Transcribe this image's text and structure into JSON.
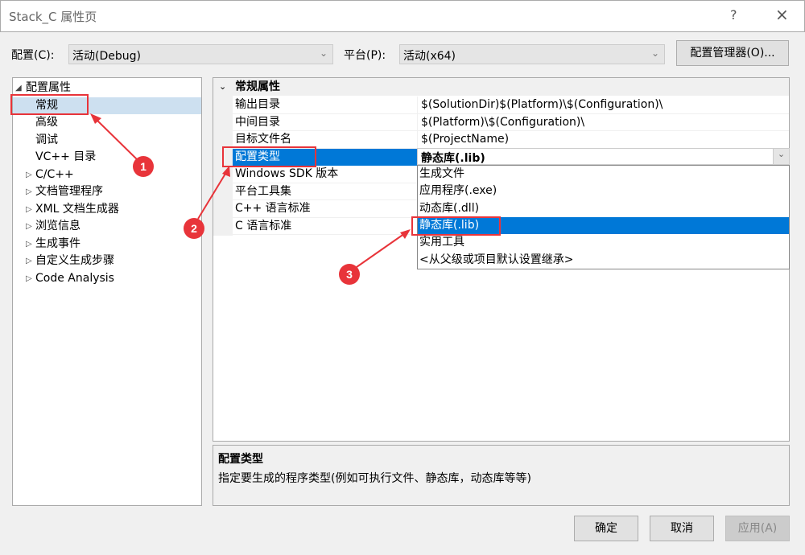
{
  "window": {
    "title": "Stack_C 属性页",
    "help": "?",
    "close": "×"
  },
  "toolbar": {
    "config_label": "配置(C):",
    "config_value": "活动(Debug)",
    "platform_label": "平台(P):",
    "platform_value": "活动(x64)",
    "config_manager": "配置管理器(O)..."
  },
  "tree": {
    "items": [
      {
        "label": "配置属性",
        "expander": "◢"
      },
      {
        "label": "常规"
      },
      {
        "label": "高级"
      },
      {
        "label": "调试"
      },
      {
        "label": "VC++ 目录"
      },
      {
        "label": "C/C++",
        "expander": "▷"
      },
      {
        "label": "文档管理程序",
        "expander": "▷"
      },
      {
        "label": "XML 文档生成器",
        "expander": "▷"
      },
      {
        "label": "浏览信息",
        "expander": "▷"
      },
      {
        "label": "生成事件",
        "expander": "▷"
      },
      {
        "label": "自定义生成步骤",
        "expander": "▷"
      },
      {
        "label": "Code Analysis",
        "expander": "▷"
      }
    ],
    "selected": "常规"
  },
  "grid": {
    "section": "常规属性",
    "rows": [
      {
        "name": "输出目录",
        "value": "$(SolutionDir)$(Platform)\\$(Configuration)\\"
      },
      {
        "name": "中间目录",
        "value": "$(Platform)\\$(Configuration)\\"
      },
      {
        "name": "目标文件名",
        "value": "$(ProjectName)"
      },
      {
        "name": "配置类型",
        "value": "静态库(.lib)"
      },
      {
        "name": "Windows SDK 版本",
        "value": ""
      },
      {
        "name": "平台工具集",
        "value": ""
      },
      {
        "name": "C++ 语言标准",
        "value": ""
      },
      {
        "name": "C 语言标准",
        "value": ""
      }
    ]
  },
  "dropdown": {
    "options": [
      "生成文件",
      "应用程序(.exe)",
      "动态库(.dll)",
      "静态库(.lib)",
      "实用工具",
      "<从父级或项目默认设置继承>"
    ],
    "selected": "静态库(.lib)"
  },
  "description": {
    "title": "配置类型",
    "text": "指定要生成的程序类型(例如可执行文件、静态库，动态库等等)"
  },
  "buttons": {
    "ok": "确定",
    "cancel": "取消",
    "apply": "应用(A)"
  },
  "annotations": {
    "color": "#e8343a",
    "markers": [
      "1",
      "2",
      "3"
    ]
  }
}
